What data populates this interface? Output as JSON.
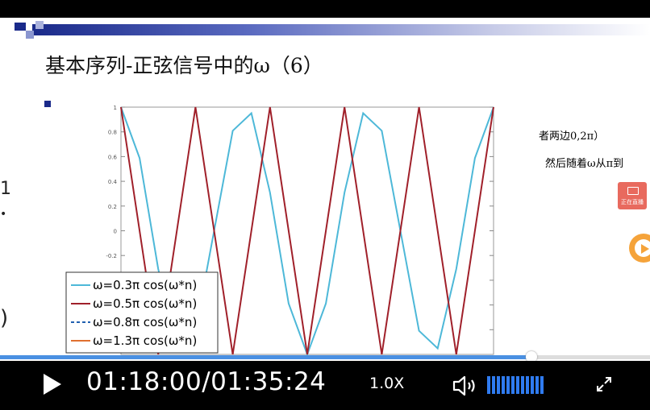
{
  "slide": {
    "title": "基本序列-正弦信号中的ω（6）",
    "side_text_1": "者两边0,2π）",
    "side_text_2": "然后随着ω从π到",
    "live_badge": "正在直播"
  },
  "chart_data": {
    "type": "line",
    "x": [
      0,
      1,
      2,
      3,
      4,
      5,
      6,
      7,
      8,
      9,
      10,
      11,
      12,
      13,
      14,
      15,
      16,
      17,
      18,
      19,
      20
    ],
    "series": [
      {
        "name": "ω=0.3π  cos(ω*n)",
        "values": [
          1.0,
          0.588,
          -0.309,
          -0.951,
          -0.809,
          0.0,
          0.809,
          0.951,
          0.309,
          -0.588,
          -1.0,
          -0.588,
          0.309,
          0.951,
          0.809,
          0.0,
          -0.809,
          -0.951,
          -0.309,
          0.588,
          1.0
        ],
        "color": "#4db8d8"
      },
      {
        "name": "ω=0.5π  cos(ω*n)",
        "values": [
          1.0,
          0.0,
          -1.0,
          0.0,
          1.0,
          0.0,
          -1.0,
          0.0,
          1.0,
          0.0,
          -1.0,
          0.0,
          1.0,
          0.0,
          -1.0,
          0.0,
          1.0,
          0.0,
          -1.0,
          0.0,
          1.0
        ],
        "color": "#a0202a"
      },
      {
        "name": "ω=0.8π  cos(ω*n)",
        "values": [],
        "color": "#2060b0",
        "dash": true
      },
      {
        "name": "ω=1.3π  cos(ω*n)",
        "values": [],
        "color": "#e07030"
      }
    ],
    "yticks": [
      "1",
      "0.8",
      "0.6",
      "0.4",
      "0.2",
      "0",
      "-0.2"
    ],
    "ylim": [
      -1,
      1
    ],
    "legend_position": "bottom-left"
  },
  "player": {
    "time": "01:18:00/01:35:24",
    "speed": "1.0X",
    "progress": 0.818,
    "volume_bars": 12,
    "accent": "#2f7bf0"
  }
}
